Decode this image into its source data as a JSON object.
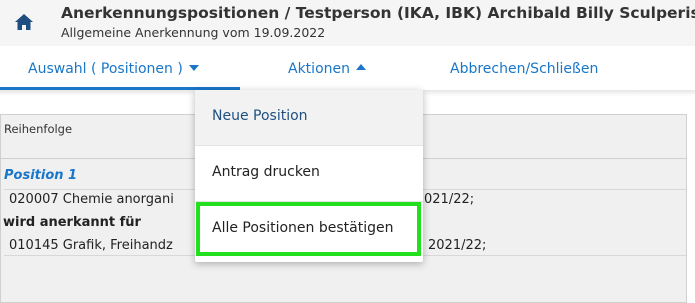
{
  "header": {
    "title": "Anerkennungspositionen  / Testperson (IKA, IBK) Archibald Billy Sculperist",
    "subtitle": "Allgemeine Anerkennung vom 19.09.2022"
  },
  "nav": {
    "auswahl": "Auswahl ( Positionen )",
    "aktionen": "Aktionen",
    "abbrechen": "Abbrechen/Schließen"
  },
  "table": {
    "column_header": "Reihenfolge",
    "position_label": "Position 1",
    "line1_left": "020007 Chemie anorgani",
    "line1_right": "021/22;",
    "recognized_label": "wird anerkannt für",
    "line2_left": "010145 Grafik, Freihandz",
    "line2_right": "2021/22;"
  },
  "menu": {
    "items": [
      "Neue Position",
      "Antrag drucken",
      "Alle Positionen bestätigen"
    ]
  },
  "colors": {
    "accent": "#1976c9",
    "highlight": "#22e01e"
  },
  "icons": {
    "home": "home-icon"
  }
}
